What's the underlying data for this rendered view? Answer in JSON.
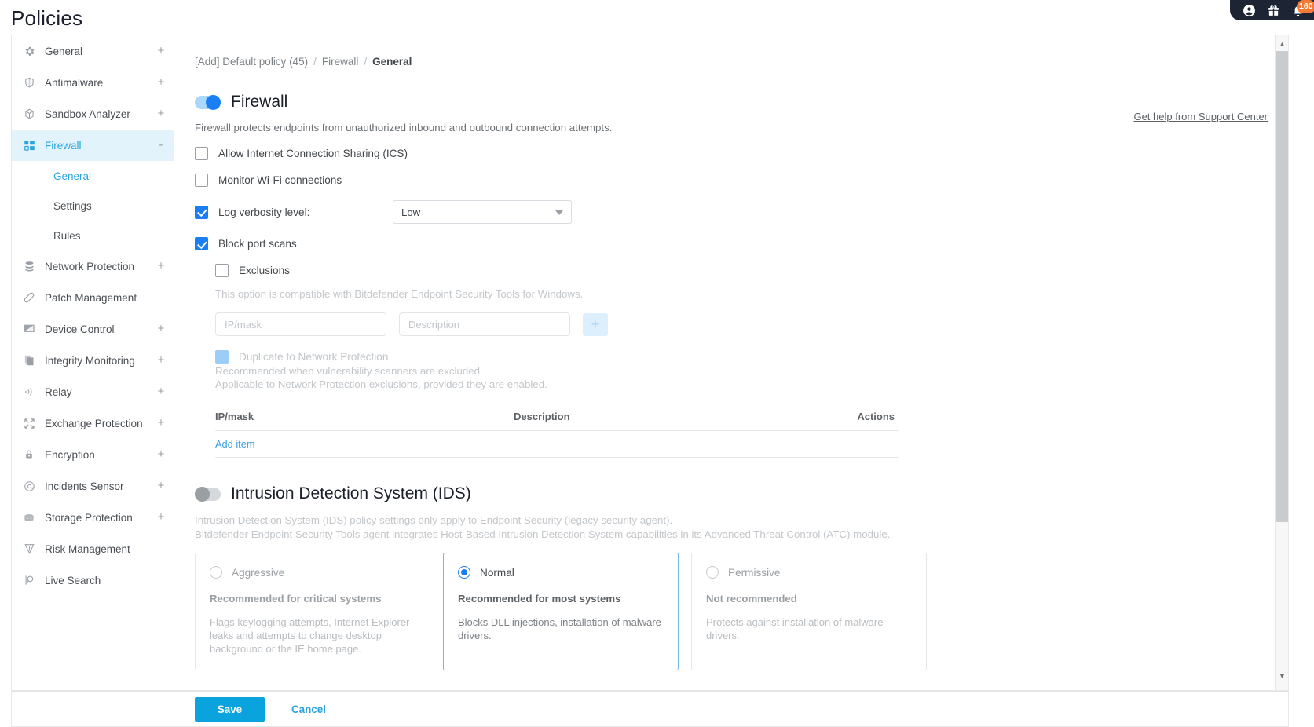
{
  "header": {
    "title": "Policies",
    "account_icon": "user-circle-icon",
    "gift_icon": "gift-icon",
    "bell_icon": "bell-icon",
    "notification_count": "160"
  },
  "sidebar": {
    "items": [
      {
        "label": "General",
        "icon": "gear-icon",
        "expander": "+",
        "active": false
      },
      {
        "label": "Antimalware",
        "icon": "shield-icon",
        "expander": "+",
        "active": false
      },
      {
        "label": "Sandbox Analyzer",
        "icon": "cube-icon",
        "expander": "+",
        "active": false
      },
      {
        "label": "Firewall",
        "icon": "firewall-blocks-icon",
        "expander": "-",
        "active": true
      },
      {
        "label": "Network Protection",
        "icon": "database-stack-icon",
        "expander": "+",
        "active": false
      },
      {
        "label": "Patch Management",
        "icon": "bandage-icon",
        "expander": "",
        "active": false
      },
      {
        "label": "Device Control",
        "icon": "monitor-icon",
        "expander": "+",
        "active": false
      },
      {
        "label": "Integrity Monitoring",
        "icon": "copy-files-icon",
        "expander": "+",
        "active": false
      },
      {
        "label": "Relay",
        "icon": "broadcast-icon",
        "expander": "+",
        "active": false
      },
      {
        "label": "Exchange Protection",
        "icon": "exchange-arrows-icon",
        "expander": "+",
        "active": false
      },
      {
        "label": "Encryption",
        "icon": "padlock-icon",
        "expander": "+",
        "active": false
      },
      {
        "label": "Incidents Sensor",
        "icon": "at-circle-icon",
        "expander": "+",
        "active": false
      },
      {
        "label": "Storage Protection",
        "icon": "storage-shield-icon",
        "expander": "+",
        "active": false
      },
      {
        "label": "Risk Management",
        "icon": "risk-funnel-icon",
        "expander": "",
        "active": false
      },
      {
        "label": "Live Search",
        "icon": "magnifier-doc-icon",
        "expander": "",
        "active": false
      }
    ],
    "subitems": [
      {
        "label": "General",
        "active": true
      },
      {
        "label": "Settings",
        "active": false
      },
      {
        "label": "Rules",
        "active": false
      }
    ]
  },
  "breadcrumb": {
    "policy": "[Add] Default policy (45)",
    "section": "Firewall",
    "page": "General",
    "separator": "/"
  },
  "support": {
    "link_label": "Get help from Support Center"
  },
  "firewall": {
    "toggle_state": "on",
    "title": "Firewall",
    "description": "Firewall protects endpoints from unauthorized inbound and outbound connection attempts.",
    "options": {
      "ics_label": "Allow Internet Connection Sharing (ICS)",
      "ics_checked": false,
      "wifi_label": "Monitor Wi-Fi connections",
      "wifi_checked": false,
      "log_label": "Log verbosity level:",
      "log_checked": true,
      "log_value": "Low",
      "port_scan_label": "Block port scans",
      "port_scan_checked": true,
      "exclusions_label": "Exclusions",
      "exclusions_checked": false,
      "compat_note": "This option is compatible with Bitdefender Endpoint Security Tools for Windows.",
      "ip_placeholder": "IP/mask",
      "desc_placeholder": "Description",
      "ip_value": "",
      "desc_value": "",
      "add_button_label": "+",
      "duplicate_label": "Duplicate to Network Protection",
      "duplicate_checked": true,
      "duplicate_note_1": "Recommended when vulnerability scanners are excluded.",
      "duplicate_note_2": "Applicable to Network Protection exclusions, provided they are enabled."
    },
    "exclusions_table": {
      "columns": [
        "IP/mask",
        "Description",
        "Actions"
      ],
      "rows": [],
      "add_item_label": "Add item"
    }
  },
  "ids": {
    "toggle_state": "off",
    "title": "Intrusion Detection System (IDS)",
    "description_line_1": "Intrusion Detection System (IDS) policy settings only apply to Endpoint Security (legacy security agent).",
    "description_line_2": "Bitdefender Endpoint Security Tools agent integrates Host-Based Intrusion Detection System capabilities in its Advanced Threat Control (ATC) module.",
    "levels": [
      {
        "name": "Aggressive",
        "selected": false,
        "subtitle": "Recommended for critical systems",
        "body": "Flags keylogging attempts, Internet Explorer leaks and attempts to change desktop background or the IE home page."
      },
      {
        "name": "Normal",
        "selected": true,
        "subtitle": "Recommended for most systems",
        "body": "Blocks DLL injections, installation of malware drivers."
      },
      {
        "name": "Permissive",
        "selected": false,
        "subtitle": "Not recommended",
        "body": "Protects against installation of malware drivers."
      }
    ]
  },
  "footer": {
    "save_label": "Save",
    "cancel_label": "Cancel"
  },
  "colors": {
    "accent_blue": "#2ba4e0",
    "toggle_on": "#1a7ef5",
    "save_button": "#0aa3dd",
    "badge_orange": "#f47b36",
    "header_pill": "#1d2433"
  }
}
